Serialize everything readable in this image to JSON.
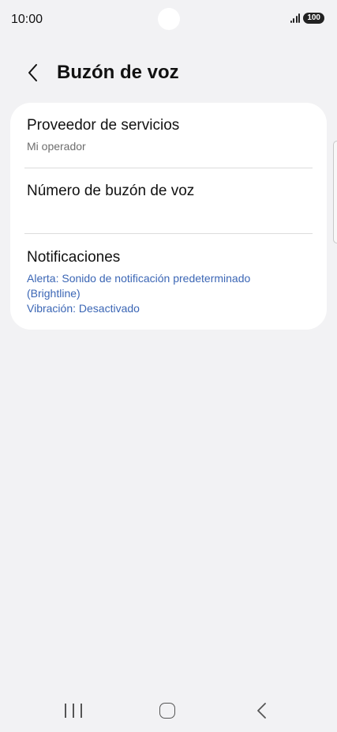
{
  "status_bar": {
    "time": "10:00",
    "battery": "100"
  },
  "header": {
    "title": "Buzón de voz"
  },
  "settings": {
    "provider": {
      "title": "Proveedor de servicios",
      "value": "Mi operador"
    },
    "voicemail_number": {
      "title": "Número de buzón de voz"
    },
    "notifications": {
      "title": "Notificaciones",
      "alert_line1": "Alerta: Sonido de notificación predeterminado",
      "alert_line2": "(Brightline)",
      "vibration": "Vibración: Desactivado"
    }
  },
  "icons": {
    "back": "back-arrow-icon",
    "signal": "signal-icon",
    "nav_recents": "recents-icon",
    "nav_home": "home-icon",
    "nav_back": "back-icon"
  },
  "colors": {
    "background": "#f2f2f4",
    "card": "#ffffff",
    "accent_blue": "#3b66b5",
    "secondary_text": "#6e6e6e"
  }
}
